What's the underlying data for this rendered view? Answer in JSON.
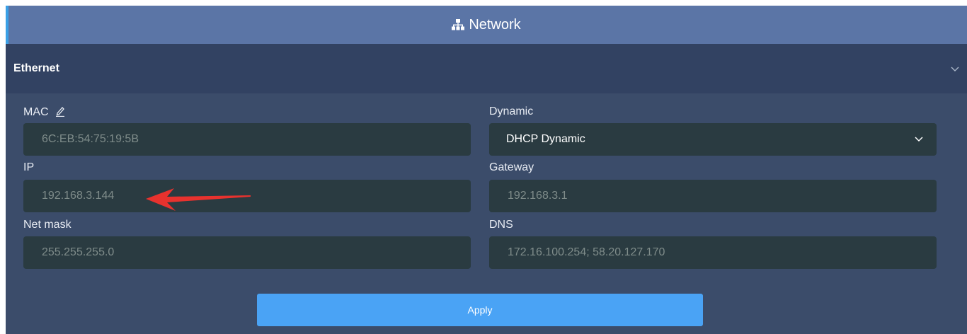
{
  "header": {
    "title": "Network",
    "icon": "sitemap-icon"
  },
  "section": {
    "title": "Ethernet"
  },
  "fields": {
    "mac": {
      "label": "MAC",
      "value": "6C:EB:54:75:19:5B"
    },
    "dynamic": {
      "label": "Dynamic",
      "value": "DHCP Dynamic"
    },
    "ip": {
      "label": "IP",
      "value": "192.168.3.144"
    },
    "gateway": {
      "label": "Gateway",
      "value": "192.168.3.1"
    },
    "netmask": {
      "label": "Net mask",
      "value": "255.255.255.0"
    },
    "dns": {
      "label": "DNS",
      "value": "172.16.100.254; 58.20.127.170"
    }
  },
  "actions": {
    "apply_label": "Apply"
  },
  "colors": {
    "header": "#5b75a6",
    "section": "#324262",
    "panel": "#3b4c6a",
    "field": "#2a3b41",
    "apply": "#4aa3f5",
    "annotation_arrow": "#e8322e"
  }
}
